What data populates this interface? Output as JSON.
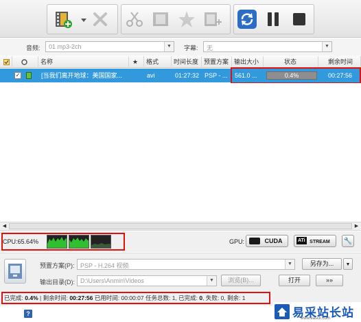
{
  "toolbar": {
    "icons": [
      "add-video-icon",
      "dropdown-arrow-icon",
      "remove-icon",
      "cut-icon",
      "clip-icon",
      "effects-icon",
      "merge-icon",
      "convert-icon",
      "pause-icon",
      "stop-icon"
    ]
  },
  "options": {
    "audio_label": "音频:",
    "audio_value": "01 mp3-2ch",
    "subtitle_label": "字幕:",
    "subtitle_value": "无"
  },
  "table": {
    "columns": [
      "名称",
      "★",
      "格式",
      "时间长度",
      "预置方案",
      "输出大小",
      "状态",
      "剩余时间"
    ],
    "rows": [
      {
        "checked": true,
        "name": "[当我们离开地球：美国国家...",
        "format": "avi",
        "duration": "01:27:32",
        "preset": "PSP - ...",
        "output_size": "561.0 ...",
        "status": "0.4%",
        "progress": 0.004,
        "remaining": "00:27:56"
      }
    ]
  },
  "cpu": {
    "label": "CPU:65.64%"
  },
  "gpu": {
    "label": "GPU:",
    "cuda": "CUDA",
    "ati_logo": "ATi",
    "stream": "STREAM"
  },
  "settings": {
    "preset_label": "预置方案(P):",
    "preset_value": "PSP - H.264 视频",
    "save_as": "另存为...",
    "output_label": "输出目录(D):",
    "output_value": "D:\\Users\\Anmin\\Videos",
    "browse": "浏览(B)...",
    "open": "打开",
    "more": "»»"
  },
  "status": {
    "completed_label": "已完成:",
    "completed": "0.4%",
    "remaining_label": "| 剩余时间:",
    "remaining": "00:27:56",
    "elapsed_label": "已用时间:",
    "elapsed": "00:00:07",
    "total_label": "任务总数:",
    "total": "1",
    "done_label": ", 已完成:",
    "done": "0",
    "failed_label": ", 失败:",
    "failed": "0",
    "left_label": ", 剩余:",
    "left": "1"
  },
  "bottom": {
    "help": "?",
    "logo_text": "易采站长站",
    "logo_sub": "www.easck.com"
  }
}
